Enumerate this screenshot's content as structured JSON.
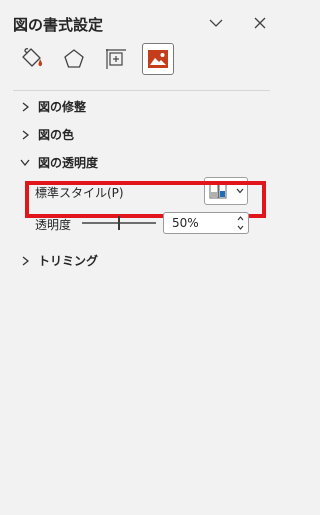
{
  "pane": {
    "title": "図の書式設定"
  },
  "tabs": [
    {
      "name": "fill-line",
      "icon": "paint-bucket-icon"
    },
    {
      "name": "effects",
      "icon": "pentagon-icon"
    },
    {
      "name": "size-properties",
      "icon": "size-icon"
    },
    {
      "name": "picture",
      "icon": "picture-icon",
      "active": true
    }
  ],
  "sections": {
    "correction": {
      "label": "図の修整",
      "expanded": false
    },
    "color": {
      "label": "図の色",
      "expanded": false
    },
    "transparency": {
      "label": "図の透明度",
      "expanded": true
    },
    "crop": {
      "label": "トリミング",
      "expanded": false
    }
  },
  "transparency": {
    "preset_label": "標準スタイル(P)",
    "transparency_label": "透明度",
    "value": "50%",
    "slider_fraction": 0.5
  },
  "colors": {
    "highlight": "#e0161c",
    "accent": "#c43e1c"
  }
}
